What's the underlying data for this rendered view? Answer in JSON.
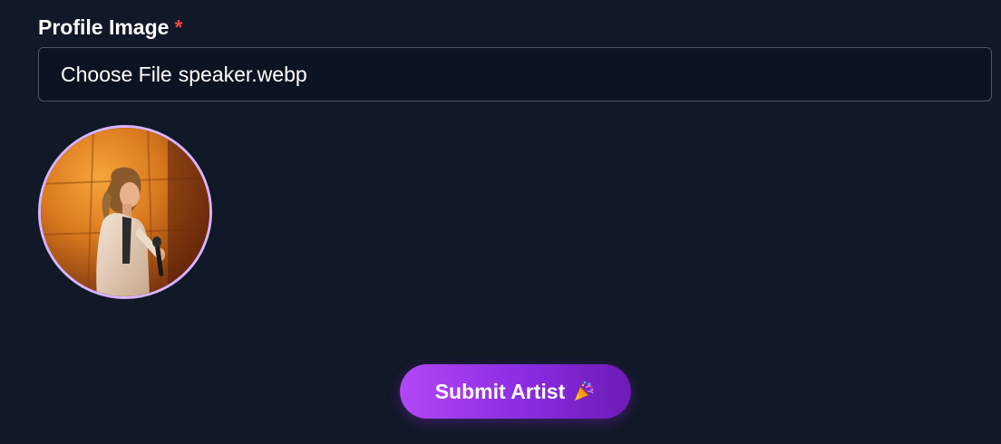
{
  "form": {
    "profile_label": "Profile Image",
    "required_mark": "*",
    "file_button_text": "Choose File",
    "file_name": "speaker.webp"
  },
  "preview": {
    "alt": "Profile image preview"
  },
  "submit": {
    "label": "Submit Artist",
    "icon": "party-popper-icon"
  },
  "colors": {
    "background": "#111827",
    "required": "#ef4444",
    "avatar_border": "#d8b4fe",
    "button_gradient_start": "#b347f5",
    "button_gradient_end": "#6d1bb5"
  }
}
